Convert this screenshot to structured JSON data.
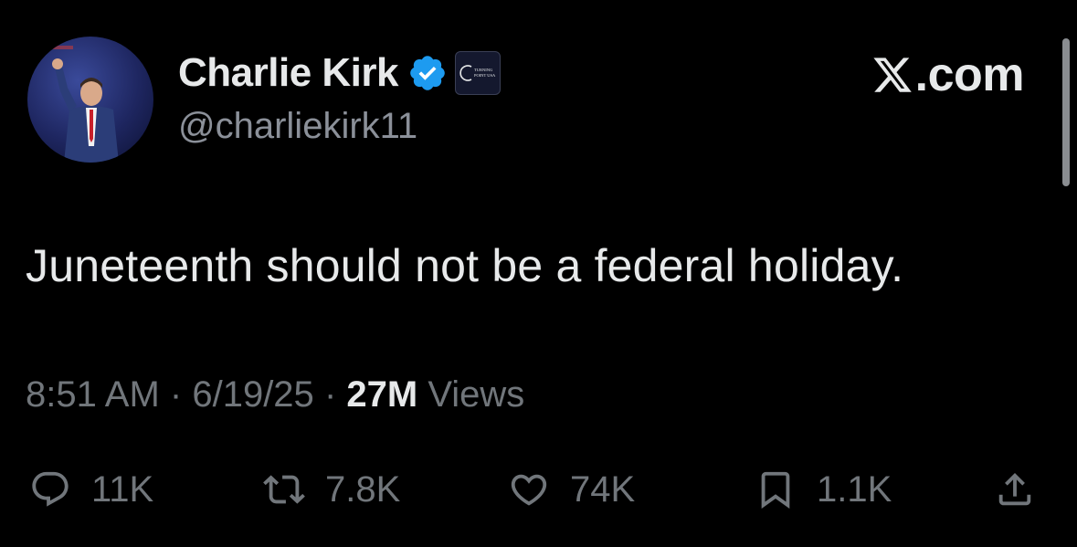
{
  "profile": {
    "display_name": "Charlie Kirk",
    "handle": "@charliekirk11",
    "avatar_icon": "profile-photo",
    "verified_icon": "verified-badge-icon",
    "affiliate_badge_icon": "turning-point-usa-logo",
    "affiliate_badge_text": "TURNING POINT USA"
  },
  "brand": {
    "logo_icon": "x-logo-icon",
    "domain": ".com"
  },
  "tweet": {
    "text": "Juneteenth should not be a federal holiday."
  },
  "meta": {
    "time": "8:51 AM",
    "separator": "·",
    "date": "6/19/25",
    "views_count": "27M",
    "views_label": "Views"
  },
  "actions": {
    "replies": {
      "icon": "reply-icon",
      "count": "11K"
    },
    "reposts": {
      "icon": "repost-icon",
      "count": "7.8K"
    },
    "likes": {
      "icon": "heart-icon",
      "count": "74K"
    },
    "bookmarks": {
      "icon": "bookmark-icon",
      "count": "1.1K"
    },
    "share": {
      "icon": "share-icon"
    }
  },
  "colors": {
    "background": "#000000",
    "primary_text": "#e7e9ea",
    "secondary_text": "#71767b",
    "verified_blue": "#1d9bf0"
  }
}
